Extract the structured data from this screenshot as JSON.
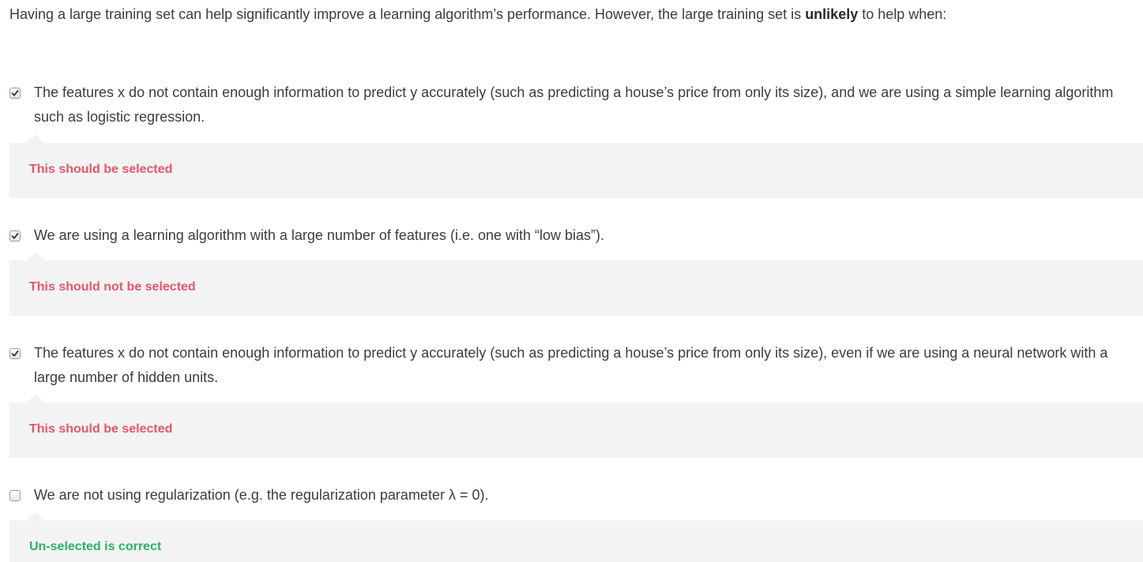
{
  "question": {
    "prefix": "Having a large training set can help significantly improve a learning algorithm’s performance. However, the large training set is ",
    "emphasis": "unlikely",
    "suffix": " to help when:"
  },
  "options": [
    {
      "text": "The features x do not contain enough information to predict y accurately (such as predicting a house’s price from only its size), and we are using a simple learning algorithm such as logistic regression.",
      "checked": true,
      "feedback": "This should be selected",
      "feedback_status": "wrong"
    },
    {
      "text": "We are using a learning algorithm with a large number of features (i.e. one with “low bias”).",
      "checked": true,
      "feedback": "This should not be selected",
      "feedback_status": "wrong"
    },
    {
      "text": "The features x do not contain enough information to predict y accurately (such as predicting a house’s price from only its size), even if we are using a neural network with a large number of hidden units.",
      "checked": true,
      "feedback": "This should be selected",
      "feedback_status": "wrong"
    },
    {
      "text": "We are not using regularization (e.g. the regularization parameter λ = 0).",
      "checked": false,
      "feedback": "Un-selected is correct",
      "feedback_status": "correct"
    }
  ],
  "colors": {
    "feedback_wrong": "#e8556c",
    "feedback_correct": "#2ab26b",
    "feedback_bg": "#f3f3f3",
    "text": "#3c3c3c"
  },
  "icons": {
    "checked": "checkbox-checked-icon",
    "unchecked": "checkbox-unchecked-icon"
  }
}
